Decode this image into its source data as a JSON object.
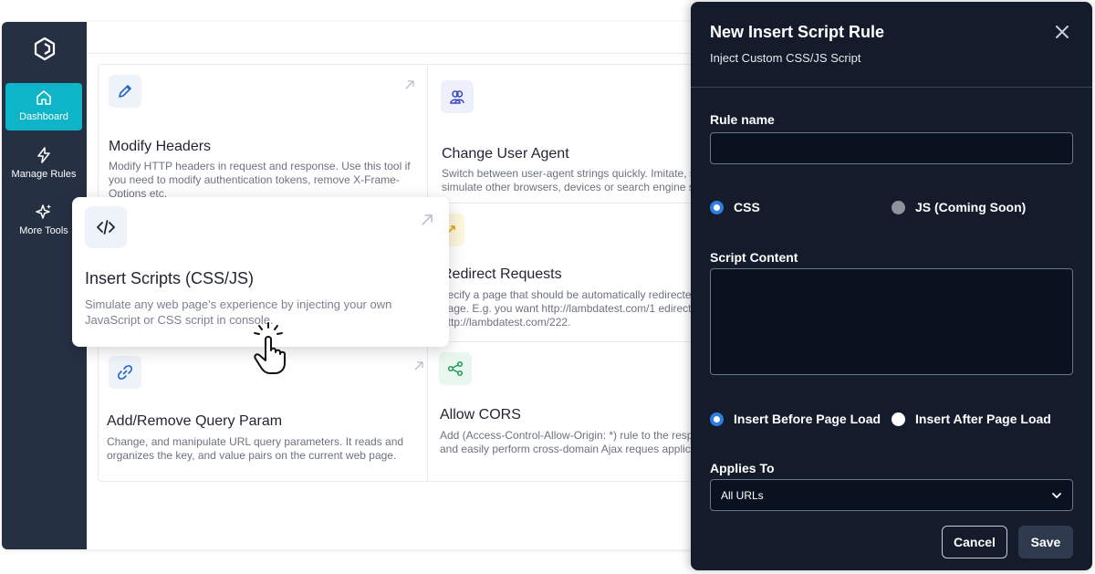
{
  "sidebar": {
    "items": [
      {
        "label": "Dashboard",
        "icon": "home-icon",
        "active": true
      },
      {
        "label": "Manage Rules",
        "icon": "lightning-icon",
        "active": false
      },
      {
        "label": "More Tools",
        "icon": "sparkle-icon",
        "active": false
      }
    ]
  },
  "cards": {
    "modify_headers": {
      "title": "Modify Headers",
      "desc": "Modify HTTP headers in request and response. Use this tool if you need to modify authentication tokens, remove X-Frame-Options etc.",
      "icon": "pencil-icon"
    },
    "change_user_agent": {
      "title": "Change User Agent",
      "desc": "Switch between user-agent strings quickly. Imitate, s simulate other browsers, devices or search engine sp",
      "icon": "users-icon"
    },
    "redirect_requests": {
      "title": "Redirect Requests",
      "desc": "pecify a page that should be automatically redirecte other page. E.g. you want http://lambdatest.com/1 edirect to http://lambdatest.com/222.",
      "icon": "trend-icon"
    },
    "add_remove_query": {
      "title": "Add/Remove Query Param",
      "desc": "Change, and manipulate URL query parameters. It reads and organizes the key, and value pairs on the current web page.",
      "icon": "link-icon"
    },
    "allow_cors": {
      "title": "Allow CORS",
      "desc": "Add (Access-Control-Allow-Origin: *) rule to the resp header and easily perform cross-domain Ajax reques applications.",
      "icon": "share-icon"
    }
  },
  "featured_card": {
    "title": "Insert Scripts (CSS/JS)",
    "desc": "Simulate any web page's experience by injecting your own JavaScript or CSS script in console.",
    "icon": "code-icon"
  },
  "panel": {
    "title": "New Insert Script Rule",
    "subtitle": "Inject Custom CSS/JS Script",
    "rule_name_label": "Rule name",
    "rule_name_value": "",
    "script_type": {
      "options": [
        {
          "label": "CSS",
          "selected": true,
          "disabled": false
        },
        {
          "label": "JS (Coming Soon)",
          "selected": false,
          "disabled": true
        }
      ]
    },
    "script_content_label": "Script Content",
    "script_content_value": "",
    "timing": {
      "options": [
        {
          "label": "Insert Before Page Load",
          "selected": true
        },
        {
          "label": "Insert After Page Load",
          "selected": false
        }
      ]
    },
    "applies_to_label": "Applies To",
    "applies_to_value": "All URLs",
    "cancel_label": "Cancel",
    "save_label": "Save"
  },
  "colors": {
    "sidebar_bg": "#253043",
    "accent": "#0eb5c9",
    "panel_bg": "#141c2b",
    "radio_selected": "#2f7de1"
  }
}
